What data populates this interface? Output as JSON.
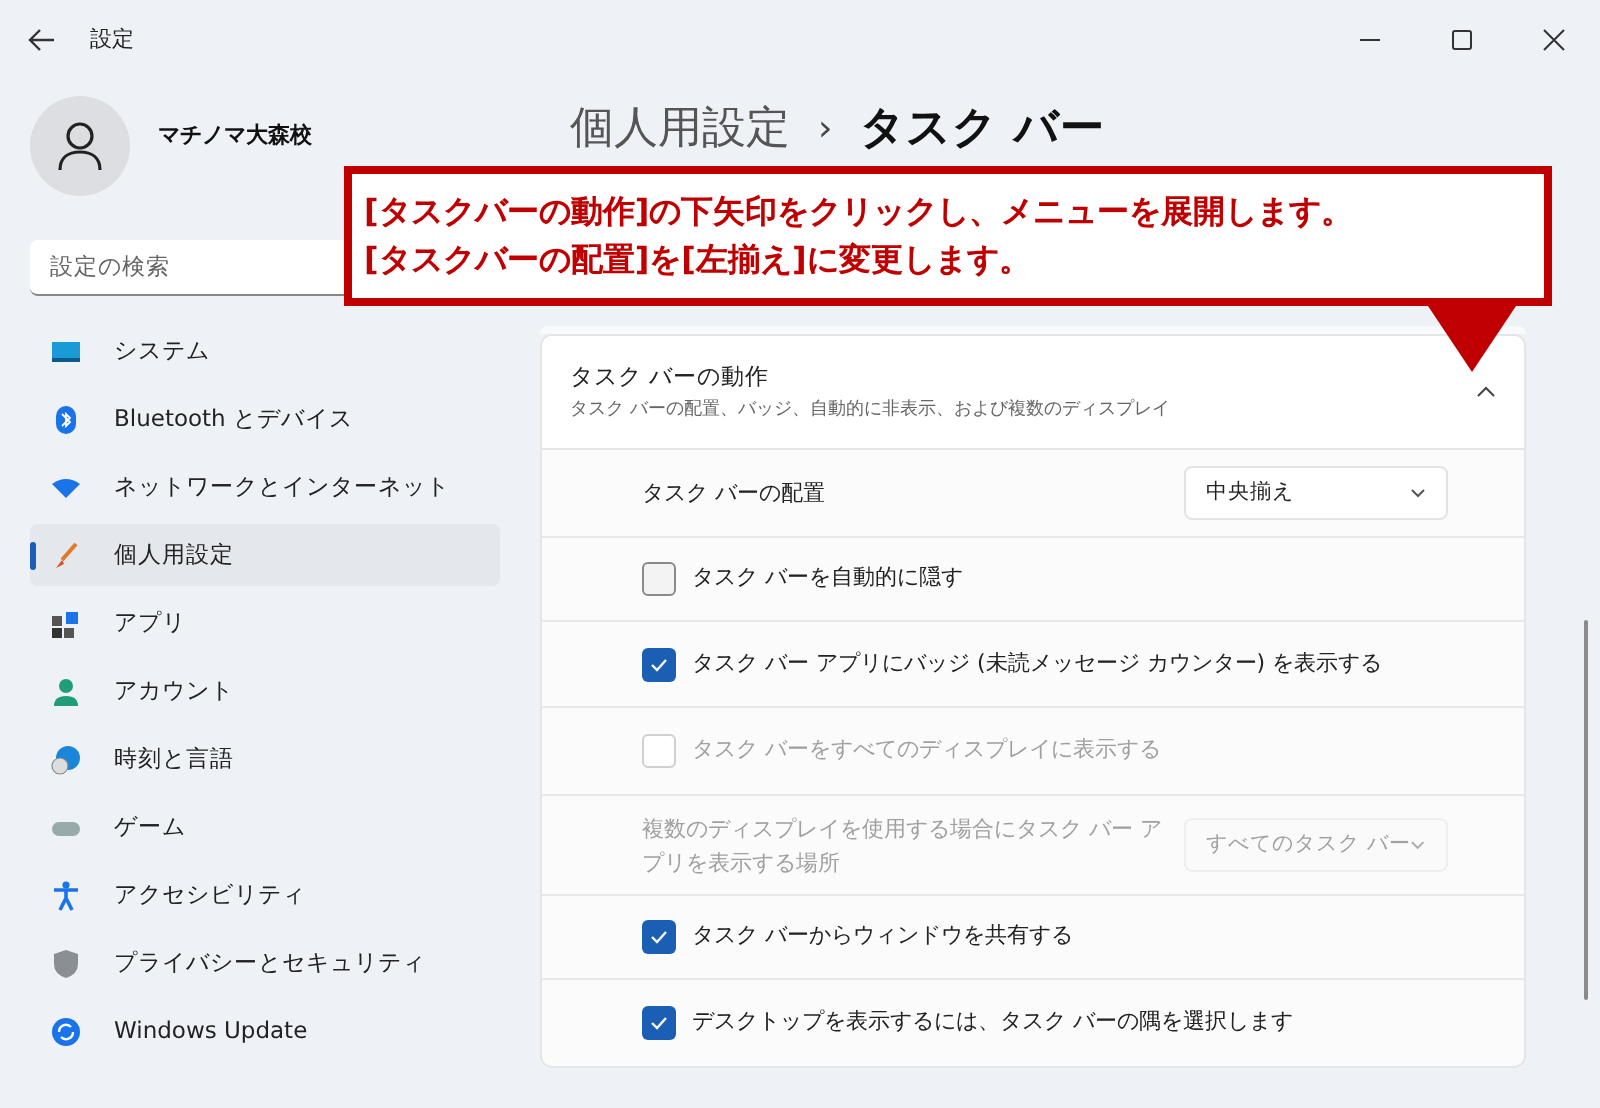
{
  "window": {
    "title": "設定"
  },
  "profile": {
    "name": "マチノマ大森校"
  },
  "search": {
    "placeholder": "設定の検索"
  },
  "sidebar": {
    "items": [
      {
        "label": "システム",
        "selected": false
      },
      {
        "label": "Bluetooth とデバイス",
        "selected": false
      },
      {
        "label": "ネットワークとインターネット",
        "selected": false
      },
      {
        "label": "個人用設定",
        "selected": true
      },
      {
        "label": "アプリ",
        "selected": false
      },
      {
        "label": "アカウント",
        "selected": false
      },
      {
        "label": "時刻と言語",
        "selected": false
      },
      {
        "label": "ゲーム",
        "selected": false
      },
      {
        "label": "アクセシビリティ",
        "selected": false
      },
      {
        "label": "プライバシーとセキュリティ",
        "selected": false
      },
      {
        "label": "Windows Update",
        "selected": false
      }
    ]
  },
  "breadcrumb": {
    "parent": "個人用設定",
    "separator": "›",
    "current": "タスク バー"
  },
  "section": {
    "title": "タスク バーの動作",
    "subtitle": "タスク バーの配置、バッジ、自動的に非表示、および複数のディスプレイ",
    "expanded": true,
    "rows": [
      {
        "kind": "dropdown",
        "label": "タスク バーの配置",
        "value": "中央揃え",
        "disabled": false
      },
      {
        "kind": "checkbox",
        "label": "タスク バーを自動的に隠す",
        "checked": false,
        "disabled": false
      },
      {
        "kind": "checkbox",
        "label": "タスク バー アプリにバッジ (未読メッセージ カウンター) を表示する",
        "checked": true,
        "disabled": false
      },
      {
        "kind": "checkbox",
        "label": "タスク バーをすべてのディスプレイに表示する",
        "checked": false,
        "disabled": true
      },
      {
        "kind": "dropdown",
        "label": "複数のディスプレイを使用する場合にタスク バー アプリを表示する場所",
        "value": "すべてのタスク バー",
        "disabled": true
      },
      {
        "kind": "checkbox",
        "label": "タスク バーからウィンドウを共有する",
        "checked": true,
        "disabled": false
      },
      {
        "kind": "checkbox",
        "label": "デスクトップを表示するには、タスク バーの隅を選択します",
        "checked": true,
        "disabled": false
      }
    ]
  },
  "callout": {
    "lines": [
      "[タスクバーの動作]の下矢印をクリックし、メニューを展開します。",
      "[タスクバーの配置]を[左揃え]に変更します。"
    ]
  }
}
